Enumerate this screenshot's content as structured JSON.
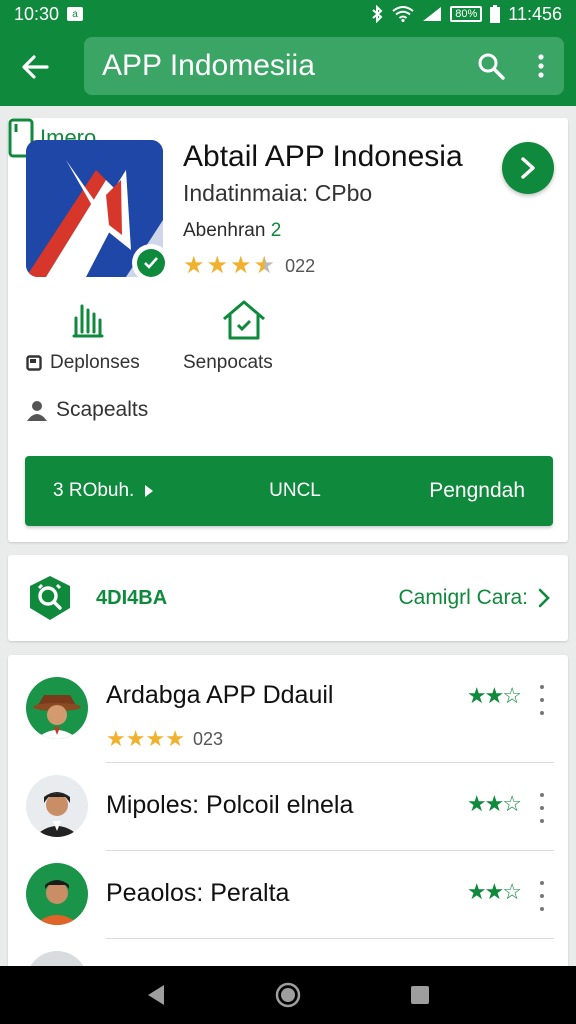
{
  "status_bar": {
    "time": "10:30",
    "badge": "a",
    "battery_label": "80%",
    "clock_right": "11:456"
  },
  "appbar": {
    "query": "APP Indomesiia"
  },
  "app": {
    "title": "Abtail APP Indonesia",
    "subtitle": "Indatinmaia: CPbo",
    "category_prefix": "Abenhran",
    "category_num": "2",
    "rating_count": "022",
    "rating": 3.5
  },
  "features": {
    "third_label": "Imero",
    "meta1": "Deplonses",
    "meta2": "Senpocats",
    "meta3": "Scapealts"
  },
  "action_bar": {
    "left": "3 RObuh.",
    "middle": "UNCL",
    "right": "Pengndah"
  },
  "section": {
    "label": "4DI4BA",
    "link": "Camigrl Cara:"
  },
  "reviews": [
    {
      "title": "Ardabga APP Ddauil",
      "stars_count": "023",
      "rating": "★★☆"
    },
    {
      "title": "Mipoles:  Polcoil elnela",
      "rating": "★★☆"
    },
    {
      "title": "Peaolos: Peralta",
      "rating": "★★☆"
    }
  ],
  "colors": {
    "primary": "#0f8a3c",
    "star": "#f0b22e"
  },
  "icons": [
    "back-arrow-icon",
    "search-icon",
    "more-vert-icon",
    "chevron-right-icon",
    "hand-icon",
    "house-icon",
    "phone-icon",
    "person-icon"
  ]
}
